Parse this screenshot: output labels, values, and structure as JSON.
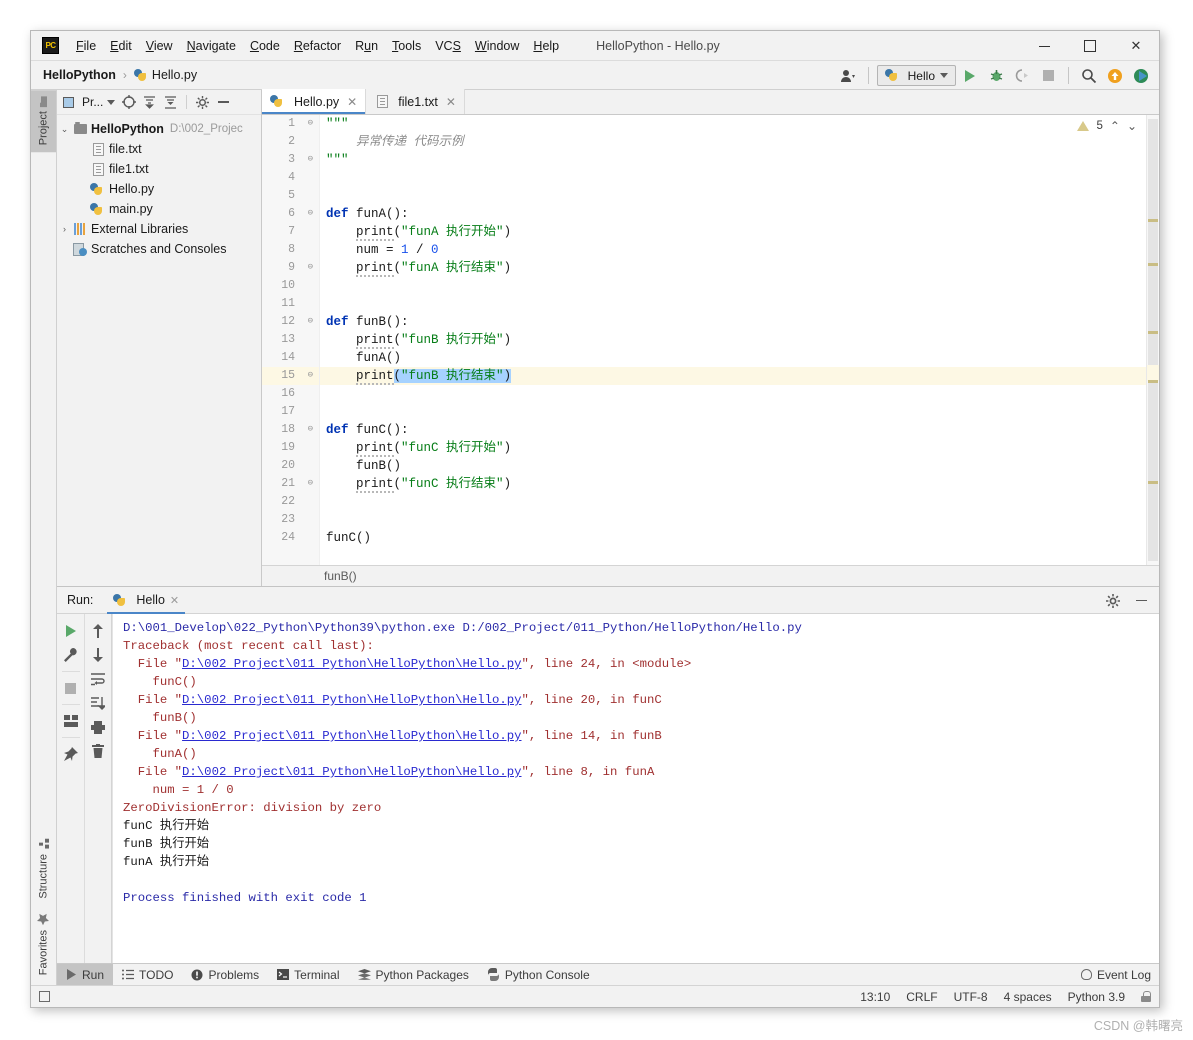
{
  "window": {
    "title": "HelloPython - Hello.py",
    "logo_text": "PC",
    "minimize": "–",
    "maximize": "□",
    "close": "✕"
  },
  "menubar": {
    "items": [
      {
        "label": "File",
        "mnemonic": "F"
      },
      {
        "label": "Edit",
        "mnemonic": "E"
      },
      {
        "label": "View",
        "mnemonic": "V"
      },
      {
        "label": "Navigate",
        "mnemonic": "N"
      },
      {
        "label": "Code",
        "mnemonic": "C"
      },
      {
        "label": "Refactor",
        "mnemonic": "R"
      },
      {
        "label": "Run",
        "mnemonic": "u"
      },
      {
        "label": "Tools",
        "mnemonic": "T"
      },
      {
        "label": "VCS",
        "mnemonic": "S"
      },
      {
        "label": "Window",
        "mnemonic": "W"
      },
      {
        "label": "Help",
        "mnemonic": "H"
      }
    ]
  },
  "navbar": {
    "crumb_project": "HelloPython",
    "crumb_sep": "›",
    "crumb_file": "Hello.py",
    "run_config": "Hello",
    "icons": [
      "user-settings-icon",
      "run-icon",
      "debug-icon",
      "coverage-icon",
      "stop-icon",
      "search-everywhere-icon",
      "updates-icon",
      "ide-features-icon"
    ]
  },
  "leftbar": {
    "top": [
      {
        "label": "Project",
        "icon": "folder-icon",
        "active": true
      }
    ],
    "bottom": [
      {
        "label": "Structure",
        "icon": "structure-icon",
        "active": false
      },
      {
        "label": "Favorites",
        "icon": "star-icon",
        "active": false
      }
    ]
  },
  "project_pane": {
    "header_label": "Pr...",
    "header_icons": [
      "project-view-icon",
      "select-opened-file-icon",
      "expand-all-icon",
      "collapse-all-icon",
      "settings-gear-icon",
      "hide-icon"
    ],
    "tree": [
      {
        "arrow": "⌄",
        "indent": 0,
        "icon": "folder-icon",
        "label": "HelloPython",
        "bold": true,
        "path": "D:\\002_Projec"
      },
      {
        "arrow": "",
        "indent": 1,
        "icon": "text-file-icon",
        "label": "file.txt",
        "bold": false,
        "path": ""
      },
      {
        "arrow": "",
        "indent": 1,
        "icon": "text-file-icon",
        "label": "file1.txt",
        "bold": false,
        "path": ""
      },
      {
        "arrow": "",
        "indent": 1,
        "icon": "python-file-icon",
        "label": "Hello.py",
        "bold": false,
        "path": ""
      },
      {
        "arrow": "",
        "indent": 1,
        "icon": "python-file-icon",
        "label": "main.py",
        "bold": false,
        "path": ""
      },
      {
        "arrow": "›",
        "indent": 0,
        "icon": "library-icon",
        "label": "External Libraries",
        "bold": false,
        "path": ""
      },
      {
        "arrow": "",
        "indent": 0,
        "icon": "scratches-icon",
        "label": "Scratches and Consoles",
        "bold": false,
        "path": ""
      }
    ]
  },
  "editor": {
    "tabs": [
      {
        "label": "Hello.py",
        "icon": "python-file-icon",
        "active": true,
        "close": "✕"
      },
      {
        "label": "file1.txt",
        "icon": "text-file-icon",
        "active": false,
        "close": "✕"
      }
    ],
    "inspection": {
      "warning_count": "5",
      "warn_icon": "warning-triangle-icon",
      "up": "⌃",
      "down": "⌄"
    },
    "breadcrumb": "funB()",
    "line_count": 25,
    "highlight_line": 15,
    "lines": [
      {
        "n": 1,
        "fold": "⊖",
        "tokens": [
          {
            "t": "\"\"\"",
            "c": "docq"
          }
        ]
      },
      {
        "n": 2,
        "fold": "",
        "tokens": [
          {
            "t": "    异常传递 代码示例",
            "c": "doc"
          }
        ]
      },
      {
        "n": 3,
        "fold": "⊖",
        "tokens": [
          {
            "t": "\"\"\"",
            "c": "docq"
          }
        ]
      },
      {
        "n": 4,
        "fold": "",
        "tokens": []
      },
      {
        "n": 5,
        "fold": "",
        "tokens": []
      },
      {
        "n": 6,
        "fold": "⊖",
        "tokens": [
          {
            "t": "def",
            "c": "kw"
          },
          {
            "t": " ",
            "c": "plain"
          },
          {
            "t": "funA",
            "c": "plain"
          },
          {
            "t": "():",
            "c": "plain"
          }
        ]
      },
      {
        "n": 7,
        "fold": "",
        "tokens": [
          {
            "t": "    ",
            "c": "plain"
          },
          {
            "t": "print",
            "c": "kwp"
          },
          {
            "t": "(",
            "c": "plain"
          },
          {
            "t": "\"funA 执行开始\"",
            "c": "str"
          },
          {
            "t": ")",
            "c": "plain"
          }
        ]
      },
      {
        "n": 8,
        "fold": "",
        "tokens": [
          {
            "t": "    num = ",
            "c": "plain"
          },
          {
            "t": "1",
            "c": "num"
          },
          {
            "t": " / ",
            "c": "plain"
          },
          {
            "t": "0",
            "c": "num"
          }
        ]
      },
      {
        "n": 9,
        "fold": "⊖",
        "tokens": [
          {
            "t": "    ",
            "c": "plain"
          },
          {
            "t": "print",
            "c": "kwp"
          },
          {
            "t": "(",
            "c": "plain"
          },
          {
            "t": "\"funA 执行结束\"",
            "c": "str"
          },
          {
            "t": ")",
            "c": "plain"
          }
        ]
      },
      {
        "n": 10,
        "fold": "",
        "tokens": []
      },
      {
        "n": 11,
        "fold": "",
        "tokens": []
      },
      {
        "n": 12,
        "fold": "⊖",
        "tokens": [
          {
            "t": "def",
            "c": "kw"
          },
          {
            "t": " ",
            "c": "plain"
          },
          {
            "t": "funB",
            "c": "plain"
          },
          {
            "t": "():",
            "c": "plain"
          }
        ]
      },
      {
        "n": 13,
        "fold": "",
        "tokens": [
          {
            "t": "    ",
            "c": "plain"
          },
          {
            "t": "print",
            "c": "kwp"
          },
          {
            "t": "(",
            "c": "plain"
          },
          {
            "t": "\"funB 执行开始\"",
            "c": "str"
          },
          {
            "t": ")",
            "c": "plain"
          }
        ]
      },
      {
        "n": 14,
        "fold": "",
        "tokens": [
          {
            "t": "    funA()",
            "c": "plain"
          }
        ]
      },
      {
        "n": 15,
        "fold": "⊖",
        "tokens": [
          {
            "t": "    ",
            "c": "plain"
          },
          {
            "t": "print",
            "c": "kwp"
          },
          {
            "t": "(",
            "c": "selp"
          },
          {
            "t": "\"funB 执行结束\"",
            "c": "sels"
          },
          {
            "t": ")",
            "c": "selp"
          }
        ]
      },
      {
        "n": 16,
        "fold": "",
        "tokens": []
      },
      {
        "n": 17,
        "fold": "",
        "tokens": []
      },
      {
        "n": 18,
        "fold": "⊖",
        "tokens": [
          {
            "t": "def",
            "c": "kw"
          },
          {
            "t": " ",
            "c": "plain"
          },
          {
            "t": "funC",
            "c": "plain"
          },
          {
            "t": "():",
            "c": "plain"
          }
        ]
      },
      {
        "n": 19,
        "fold": "",
        "tokens": [
          {
            "t": "    ",
            "c": "plain"
          },
          {
            "t": "print",
            "c": "kwp"
          },
          {
            "t": "(",
            "c": "plain"
          },
          {
            "t": "\"funC 执行开始\"",
            "c": "str"
          },
          {
            "t": ")",
            "c": "plain"
          }
        ]
      },
      {
        "n": 20,
        "fold": "",
        "tokens": [
          {
            "t": "    funB()",
            "c": "plain"
          }
        ]
      },
      {
        "n": 21,
        "fold": "⊖",
        "tokens": [
          {
            "t": "    ",
            "c": "plain"
          },
          {
            "t": "print",
            "c": "kwp"
          },
          {
            "t": "(",
            "c": "plain"
          },
          {
            "t": "\"funC 执行结束\"",
            "c": "str"
          },
          {
            "t": ")",
            "c": "plain"
          }
        ]
      },
      {
        "n": 22,
        "fold": "",
        "tokens": []
      },
      {
        "n": 23,
        "fold": "",
        "tokens": []
      },
      {
        "n": 24,
        "fold": "",
        "tokens": [
          {
            "t": "funC()",
            "c": "plain"
          }
        ]
      }
    ]
  },
  "run_panel": {
    "label": "Run:",
    "tab_label": "Hello",
    "tab_close": "✕",
    "header_icons": [
      "settings-gear-icon",
      "hide-panel-icon"
    ],
    "toolbar_col1": [
      "rerun-icon",
      "wrench-icon",
      "stop-icon",
      "layout-icon",
      "pin-tab-icon"
    ],
    "toolbar_col2": [
      "up-arrow-icon",
      "down-arrow-icon",
      "soft-wrap-icon",
      "scroll-to-end-icon",
      "print-icon",
      "clear-all-icon"
    ],
    "console_lines": [
      [
        {
          "t": "D:\\001_Develop\\022_Python\\Python39\\python.exe D:/002_Project/011_Python/HelloPython/Hello.py",
          "c": "c-blue"
        }
      ],
      [
        {
          "t": "Traceback (most recent call last):",
          "c": "c-red"
        }
      ],
      [
        {
          "t": "  File \"",
          "c": "c-red"
        },
        {
          "t": "D:\\002 Project\\011 Python\\HelloPython\\Hello.py",
          "c": "c-link"
        },
        {
          "t": "\", line 24, in <module>",
          "c": "c-red"
        }
      ],
      [
        {
          "t": "    funC()",
          "c": "c-red"
        }
      ],
      [
        {
          "t": "  File \"",
          "c": "c-red"
        },
        {
          "t": "D:\\002 Project\\011 Python\\HelloPython\\Hello.py",
          "c": "c-link"
        },
        {
          "t": "\", line 20, in funC",
          "c": "c-red"
        }
      ],
      [
        {
          "t": "    funB()",
          "c": "c-red"
        }
      ],
      [
        {
          "t": "  File \"",
          "c": "c-red"
        },
        {
          "t": "D:\\002 Project\\011 Python\\HelloPython\\Hello.py",
          "c": "c-link"
        },
        {
          "t": "\", line 14, in funB",
          "c": "c-red"
        }
      ],
      [
        {
          "t": "    funA()",
          "c": "c-red"
        }
      ],
      [
        {
          "t": "  File \"",
          "c": "c-red"
        },
        {
          "t": "D:\\002 Project\\011 Python\\HelloPython\\Hello.py",
          "c": "c-link"
        },
        {
          "t": "\", line 8, in funA",
          "c": "c-red"
        }
      ],
      [
        {
          "t": "    num = 1 / 0",
          "c": "c-red"
        }
      ],
      [
        {
          "t": "ZeroDivisionError: division by zero",
          "c": "c-red"
        }
      ],
      [
        {
          "t": "funC 执行开始",
          "c": "c-dark"
        }
      ],
      [
        {
          "t": "funB 执行开始",
          "c": "c-dark"
        }
      ],
      [
        {
          "t": "funA 执行开始",
          "c": "c-dark"
        }
      ],
      [],
      [
        {
          "t": "Process finished with exit code 1",
          "c": "c-blue"
        }
      ]
    ]
  },
  "bottom_tabs": {
    "items": [
      {
        "label": "Run",
        "icon": "run-icon",
        "active": true
      },
      {
        "label": "TODO",
        "icon": "todo-icon",
        "active": false
      },
      {
        "label": "Problems",
        "icon": "problems-icon",
        "active": false
      },
      {
        "label": "Terminal",
        "icon": "terminal-icon",
        "active": false
      },
      {
        "label": "Python Packages",
        "icon": "packages-icon",
        "active": false
      },
      {
        "label": "Python Console",
        "icon": "python-console-icon",
        "active": false
      }
    ],
    "event_log": "Event Log",
    "event_log_icon": "bell-icon"
  },
  "statusbar": {
    "toggle_icon": "toggle-toolwindows-icon",
    "caret_position": "13:10",
    "line_separator": "CRLF",
    "encoding": "UTF-8",
    "indent": "4 spaces",
    "interpreter": "Python 3.9",
    "lock_icon": "lock-icon"
  },
  "watermark": "CSDN @韩曙亮",
  "colors": {
    "accent_blue": "#4a86c8",
    "run_green": "#59a869",
    "keyword": "#0033b3",
    "string": "#067d17",
    "number": "#1750eb",
    "error_red": "#a03030",
    "link_blue": "#2a2ad0",
    "highlight_line": "#fdf8e4",
    "selection": "#a6d2ff"
  }
}
